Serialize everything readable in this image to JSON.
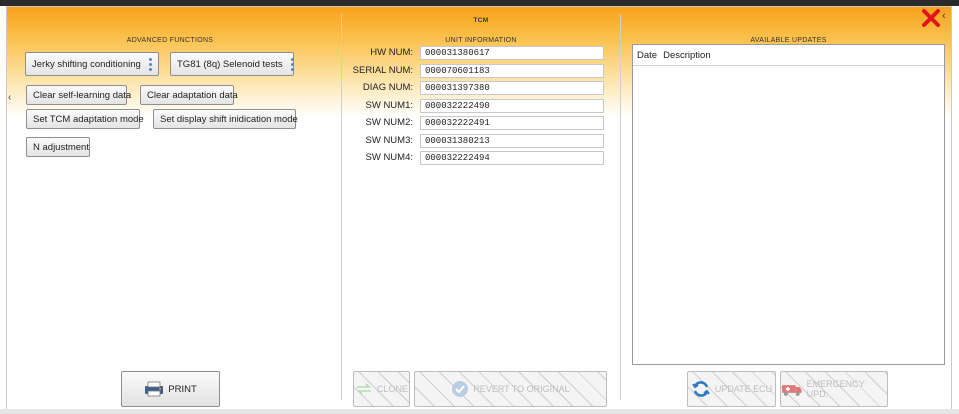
{
  "colors": {
    "accent": "#f7a21a",
    "kebab": "#5a82c8",
    "close": "#e0141e"
  },
  "left_panel": {
    "title": "ADVANCED FUNCTIONS",
    "buttons": [
      {
        "label": "Jerky shifting conditioning"
      },
      {
        "label": "TG81 (8q) Selenoid tests"
      },
      {
        "label": "Clear self-learning data"
      },
      {
        "label": "Clear adaptation data"
      },
      {
        "label": "Set TCM adaptation mode"
      },
      {
        "label": "Set display shift inidication mode"
      },
      {
        "label": "N adjustment"
      }
    ],
    "print_label": "PRINT"
  },
  "middle_panel": {
    "title": "TCM",
    "subtitle": "UNIT INFORMATION",
    "fields": [
      {
        "label": "HW NUM:",
        "value": "000031380617"
      },
      {
        "label": "SERIAL NUM:",
        "value": "000070601183"
      },
      {
        "label": "DIAG NUM:",
        "value": "000031397380"
      },
      {
        "label": "SW NUM1:",
        "value": "000032222490"
      },
      {
        "label": "SW NUM2:",
        "value": "000032222491"
      },
      {
        "label": "SW NUM3:",
        "value": "000031380213"
      },
      {
        "label": "SW NUM4:",
        "value": "000032222494"
      }
    ],
    "clone_label": "CLONE",
    "revert_label": "REVERT TO ORIGINAL"
  },
  "right_panel": {
    "title": "AVAILABLE UPDATES",
    "columns": [
      "Date",
      "Description"
    ],
    "update_ecu_label": "UPDATE ECU",
    "emergency_label": "EMERGENCY UPD."
  }
}
